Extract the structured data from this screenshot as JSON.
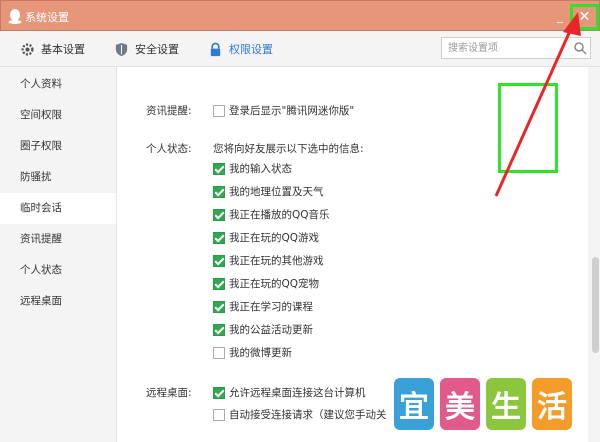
{
  "window": {
    "title": "系统设置",
    "minimize": "_",
    "close": "✕"
  },
  "toolbar": {
    "tabs": [
      {
        "label": "基本设置",
        "icon": "gear-icon"
      },
      {
        "label": "安全设置",
        "icon": "shield-icon"
      },
      {
        "label": "权限设置",
        "icon": "lock-icon"
      }
    ],
    "active_tab": "权限设置",
    "search_placeholder": "搜索设置项"
  },
  "sidebar": {
    "items": [
      {
        "label": "个人资料"
      },
      {
        "label": "空间权限"
      },
      {
        "label": "圈子权限"
      },
      {
        "label": "防骚扰"
      },
      {
        "label": "临时会话"
      },
      {
        "label": "资讯提醒"
      },
      {
        "label": "个人状态"
      },
      {
        "label": "远程桌面"
      }
    ],
    "active": "临时会话"
  },
  "content": {
    "news": {
      "label": "资讯提醒:",
      "option": {
        "text": "登录后显示\"腾讯网迷你版\"",
        "checked": false
      }
    },
    "status": {
      "label": "个人状态:",
      "intro": "您将向好友展示以下选中的信息:",
      "options": [
        {
          "text": "我的输入状态",
          "checked": true
        },
        {
          "text": "我的地理位置及天气",
          "checked": true
        },
        {
          "text": "我正在播放的QQ音乐",
          "checked": true
        },
        {
          "text": "我正在玩的QQ游戏",
          "checked": true
        },
        {
          "text": "我正在玩的其他游戏",
          "checked": true
        },
        {
          "text": "我正在玩的QQ宠物",
          "checked": true
        },
        {
          "text": "我正在学习的课程",
          "checked": true
        },
        {
          "text": "我的公益活动更新",
          "checked": true
        },
        {
          "text": "我的微博更新",
          "checked": false
        }
      ]
    },
    "remote": {
      "label": "远程桌面:",
      "options": [
        {
          "text": "允许远程桌面连接这台计算机",
          "checked": true
        },
        {
          "text": "自动接受连接请求（建议您手动关",
          "checked": false
        }
      ]
    }
  },
  "watermark": {
    "chars": [
      "宜",
      "美",
      "生",
      "活"
    ],
    "colors": [
      "#3aa0d8",
      "#e05a8a",
      "#8cc63f",
      "#f39c2a"
    ]
  },
  "colors": {
    "titlebar": "#e6977a",
    "accent": "#2e7bd2",
    "highlight": "#2ee32a",
    "arrow": "#e8262a",
    "checkbox": "#2fa84f"
  }
}
